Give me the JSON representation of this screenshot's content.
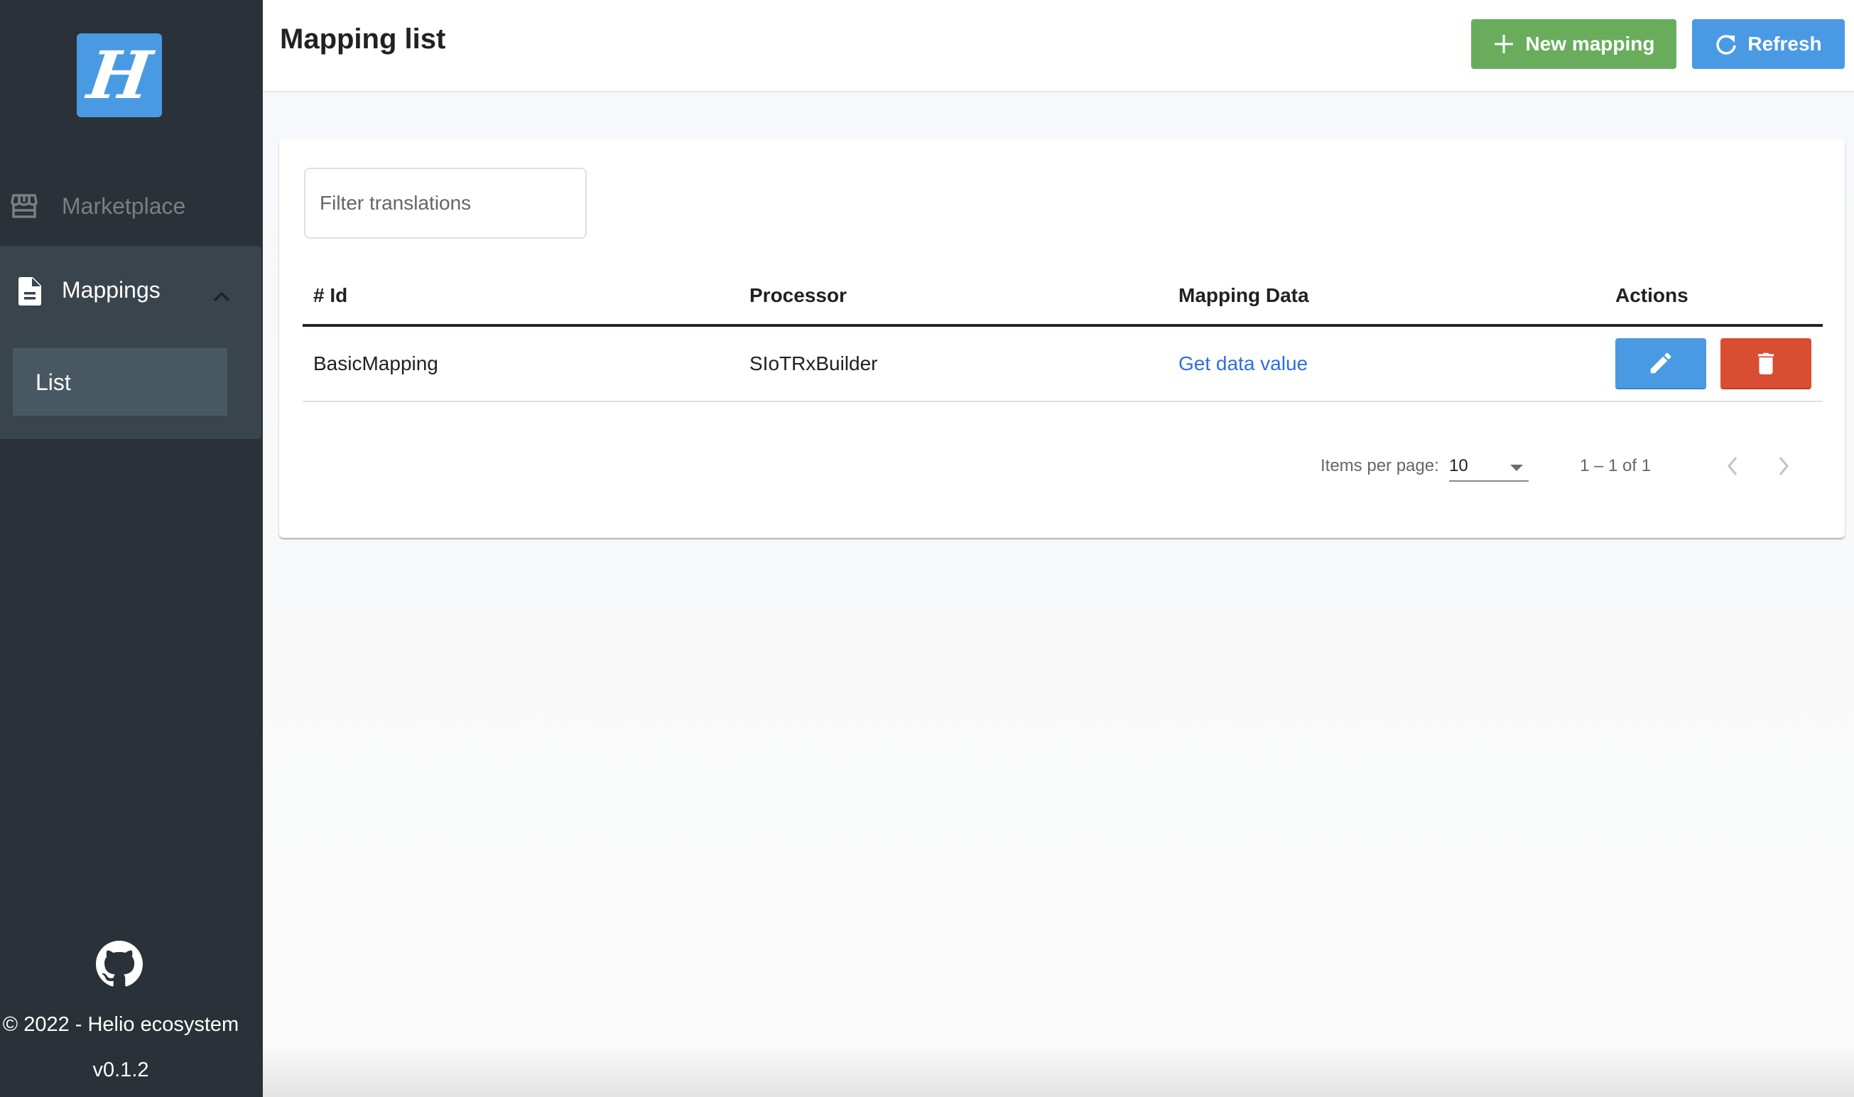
{
  "app": {
    "logo_letter": "H",
    "brand_color": "#4a9ae3"
  },
  "sidebar": {
    "items": [
      {
        "label": "Marketplace",
        "icon": "store-icon"
      },
      {
        "label": "Mappings",
        "icon": "file-document-icon",
        "expanded": true,
        "children": [
          {
            "label": "List",
            "active": true
          }
        ]
      }
    ],
    "footer": {
      "github_icon": "github-icon",
      "copyright": "© 2022 - Helio ecosystem",
      "version": "v0.1.2"
    }
  },
  "header": {
    "title": "Mapping list",
    "new_button": {
      "label": "New mapping",
      "icon": "plus-icon",
      "color": "#69ad5c"
    },
    "refresh_button": {
      "label": "Refresh",
      "icon": "refresh-icon",
      "color": "#4a9ae3"
    }
  },
  "filter": {
    "placeholder": "Filter translations",
    "value": ""
  },
  "table": {
    "columns": [
      "# Id",
      "Processor",
      "Mapping Data",
      "Actions"
    ],
    "rows": [
      {
        "id": "BasicMapping",
        "processor": "SIoTRxBuilder",
        "mapping_data": "Get data value",
        "actions": [
          {
            "name": "edit",
            "icon": "pencil-icon",
            "color": "#4a9ae3"
          },
          {
            "name": "delete",
            "icon": "trash-icon",
            "color": "#d94d33"
          }
        ]
      }
    ]
  },
  "paginator": {
    "items_per_page_label": "Items per page:",
    "items_per_page": "10",
    "range": "1 – 1 of 1"
  }
}
